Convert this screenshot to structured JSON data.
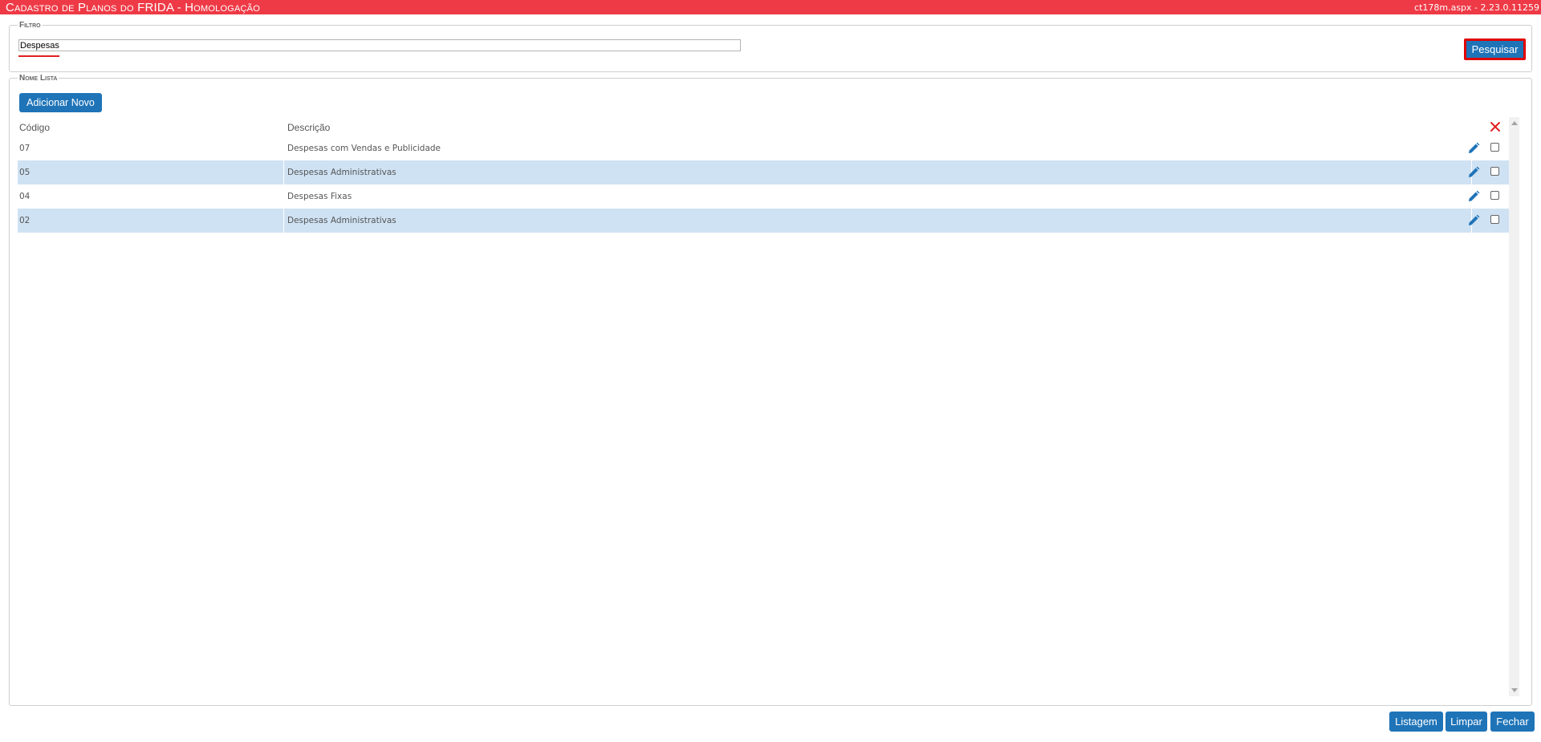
{
  "header": {
    "title": "Cadastro de Planos do FRIDA  - Homologação",
    "version": "ct178m.aspx - 2.23.0.11259"
  },
  "filtro": {
    "legend": "Filtro",
    "value": "Despesas",
    "search_label": "Pesquisar"
  },
  "lista": {
    "legend": "Nome Lista",
    "add_label": "Adicionar Novo",
    "columns": {
      "code": "Código",
      "desc": "Descrição"
    },
    "rows": [
      {
        "code": "07",
        "desc": "Despesas com Vendas e Publicidade"
      },
      {
        "code": "05",
        "desc": "Despesas Administrativas"
      },
      {
        "code": "04",
        "desc": "Despesas Fixas"
      },
      {
        "code": "02",
        "desc": "Despesas Administrativas"
      }
    ]
  },
  "footer": {
    "listagem": "Listagem",
    "limpar": "Limpar",
    "fechar": "Fechar"
  },
  "colors": {
    "title_bar": "#ee3a46",
    "button": "#1f74b8",
    "row_alt": "#cfe2f3",
    "delete_icon": "#e02020"
  },
  "icons": {
    "edit": "pencil-icon",
    "delete_all": "close-icon"
  }
}
